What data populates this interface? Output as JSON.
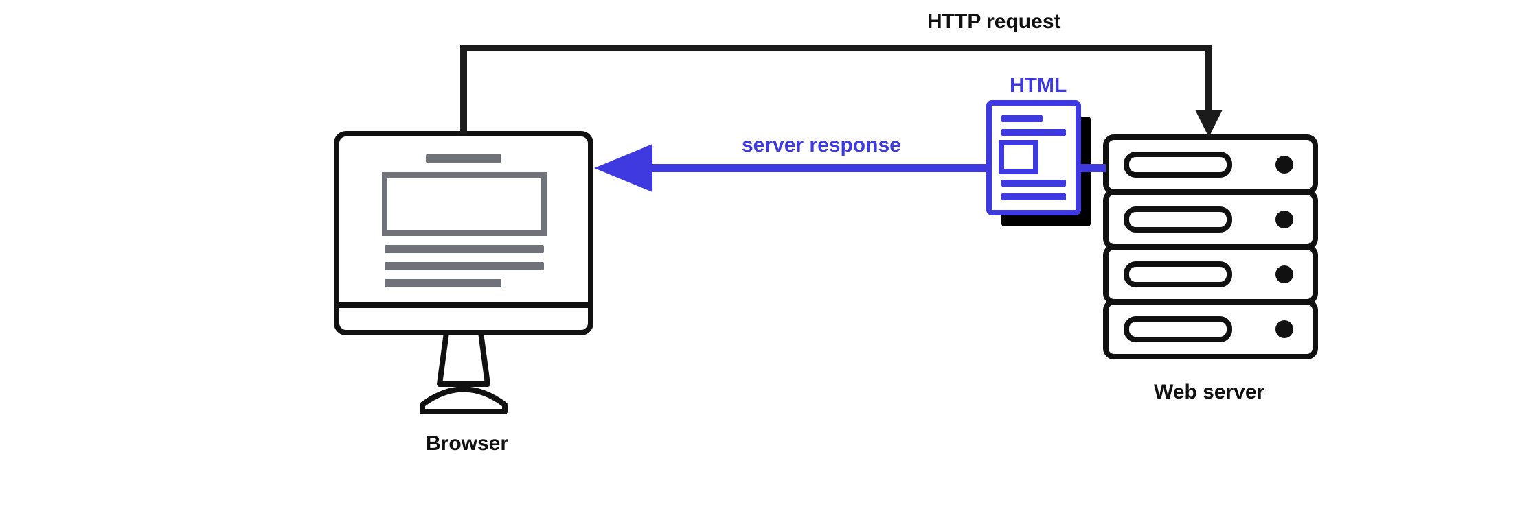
{
  "diagram": {
    "request_label": "HTTP request",
    "response_label": "server response",
    "browser_label": "Browser",
    "server_label": "Web server",
    "html_doc_label": "HTML",
    "colors": {
      "stroke": "#111111",
      "fill_gray": "#6f7279",
      "accent_blue": "#3e3ae0",
      "shadow": "#000000"
    },
    "nodes": [
      {
        "id": "browser",
        "type": "client-computer"
      },
      {
        "id": "web-server",
        "type": "server-rack"
      },
      {
        "id": "html-document",
        "type": "document-payload"
      }
    ],
    "edges": [
      {
        "from": "browser",
        "to": "web-server",
        "label_key": "request_label",
        "style": "black-arrow"
      },
      {
        "from": "web-server",
        "to": "browser",
        "label_key": "response_label",
        "style": "blue-arrow",
        "payload": "html-document"
      }
    ]
  }
}
